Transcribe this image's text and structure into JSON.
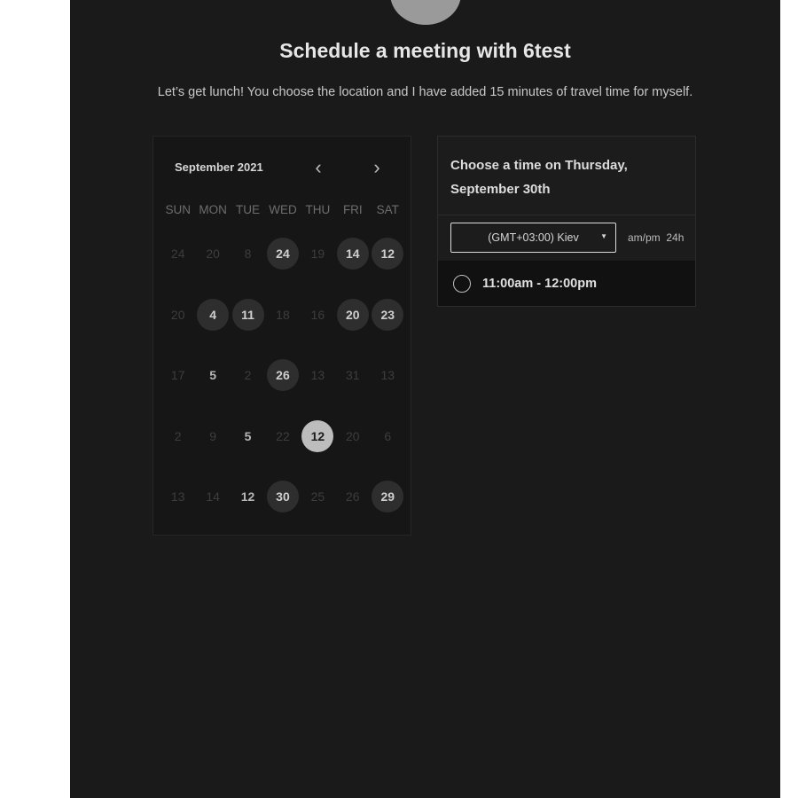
{
  "header": {
    "title": "Schedule a meeting with 6test",
    "subtitle": "Let’s get lunch! You choose the location and I have added 15 minutes of travel time for myself."
  },
  "calendar": {
    "month_label": "September 2021",
    "prev_icon": "chevron-left-icon",
    "next_icon": "chevron-right-icon",
    "weekdays": [
      "SUN",
      "MON",
      "TUE",
      "WED",
      "THU",
      "FRI",
      "SAT"
    ],
    "weeks": [
      [
        {
          "d": "24",
          "s": "dim"
        },
        {
          "d": "20",
          "s": "dim"
        },
        {
          "d": "8",
          "s": "dim"
        },
        {
          "d": "24",
          "s": "avail"
        },
        {
          "d": "19",
          "s": "dim"
        },
        {
          "d": "14",
          "s": "avail"
        },
        {
          "d": "12",
          "s": "avail"
        }
      ],
      [
        {
          "d": "20",
          "s": "dim"
        },
        {
          "d": "4",
          "s": "avail"
        },
        {
          "d": "11",
          "s": "avail"
        },
        {
          "d": "18",
          "s": "dim"
        },
        {
          "d": "16",
          "s": "dim"
        },
        {
          "d": "20",
          "s": "avail"
        },
        {
          "d": "23",
          "s": "avail"
        }
      ],
      [
        {
          "d": "17",
          "s": "dim"
        },
        {
          "d": "5",
          "s": "plain"
        },
        {
          "d": "2",
          "s": "dim"
        },
        {
          "d": "26",
          "s": "avail"
        },
        {
          "d": "13",
          "s": "dim"
        },
        {
          "d": "31",
          "s": "dim"
        },
        {
          "d": "13",
          "s": "dim"
        }
      ],
      [
        {
          "d": "2",
          "s": "dim"
        },
        {
          "d": "9",
          "s": "dim"
        },
        {
          "d": "5",
          "s": "plain"
        },
        {
          "d": "22",
          "s": "dim"
        },
        {
          "d": "12",
          "s": "selected"
        },
        {
          "d": "20",
          "s": "dim"
        },
        {
          "d": "6",
          "s": "dim"
        }
      ],
      [
        {
          "d": "13",
          "s": "dim"
        },
        {
          "d": "14",
          "s": "dim"
        },
        {
          "d": "12",
          "s": "plain"
        },
        {
          "d": "30",
          "s": "avail"
        },
        {
          "d": "25",
          "s": "dim"
        },
        {
          "d": "26",
          "s": "dim"
        },
        {
          "d": "29",
          "s": "avail"
        }
      ]
    ]
  },
  "time_panel": {
    "heading": "Choose a time on Thursday, September 30th",
    "timezone": "(GMT+03:00) Kiev",
    "timezone_caret_icon": "caret-down-icon",
    "format_ampm": "am/pm",
    "format_24h": "24h",
    "slots": [
      {
        "label": "11:00am - 12:00pm",
        "icon": "radio-circle-icon"
      }
    ]
  },
  "colors": {
    "page_bg": "#1a1a1a",
    "available_day": "#2e2e2e",
    "selected_day": "#bdbdbd"
  }
}
